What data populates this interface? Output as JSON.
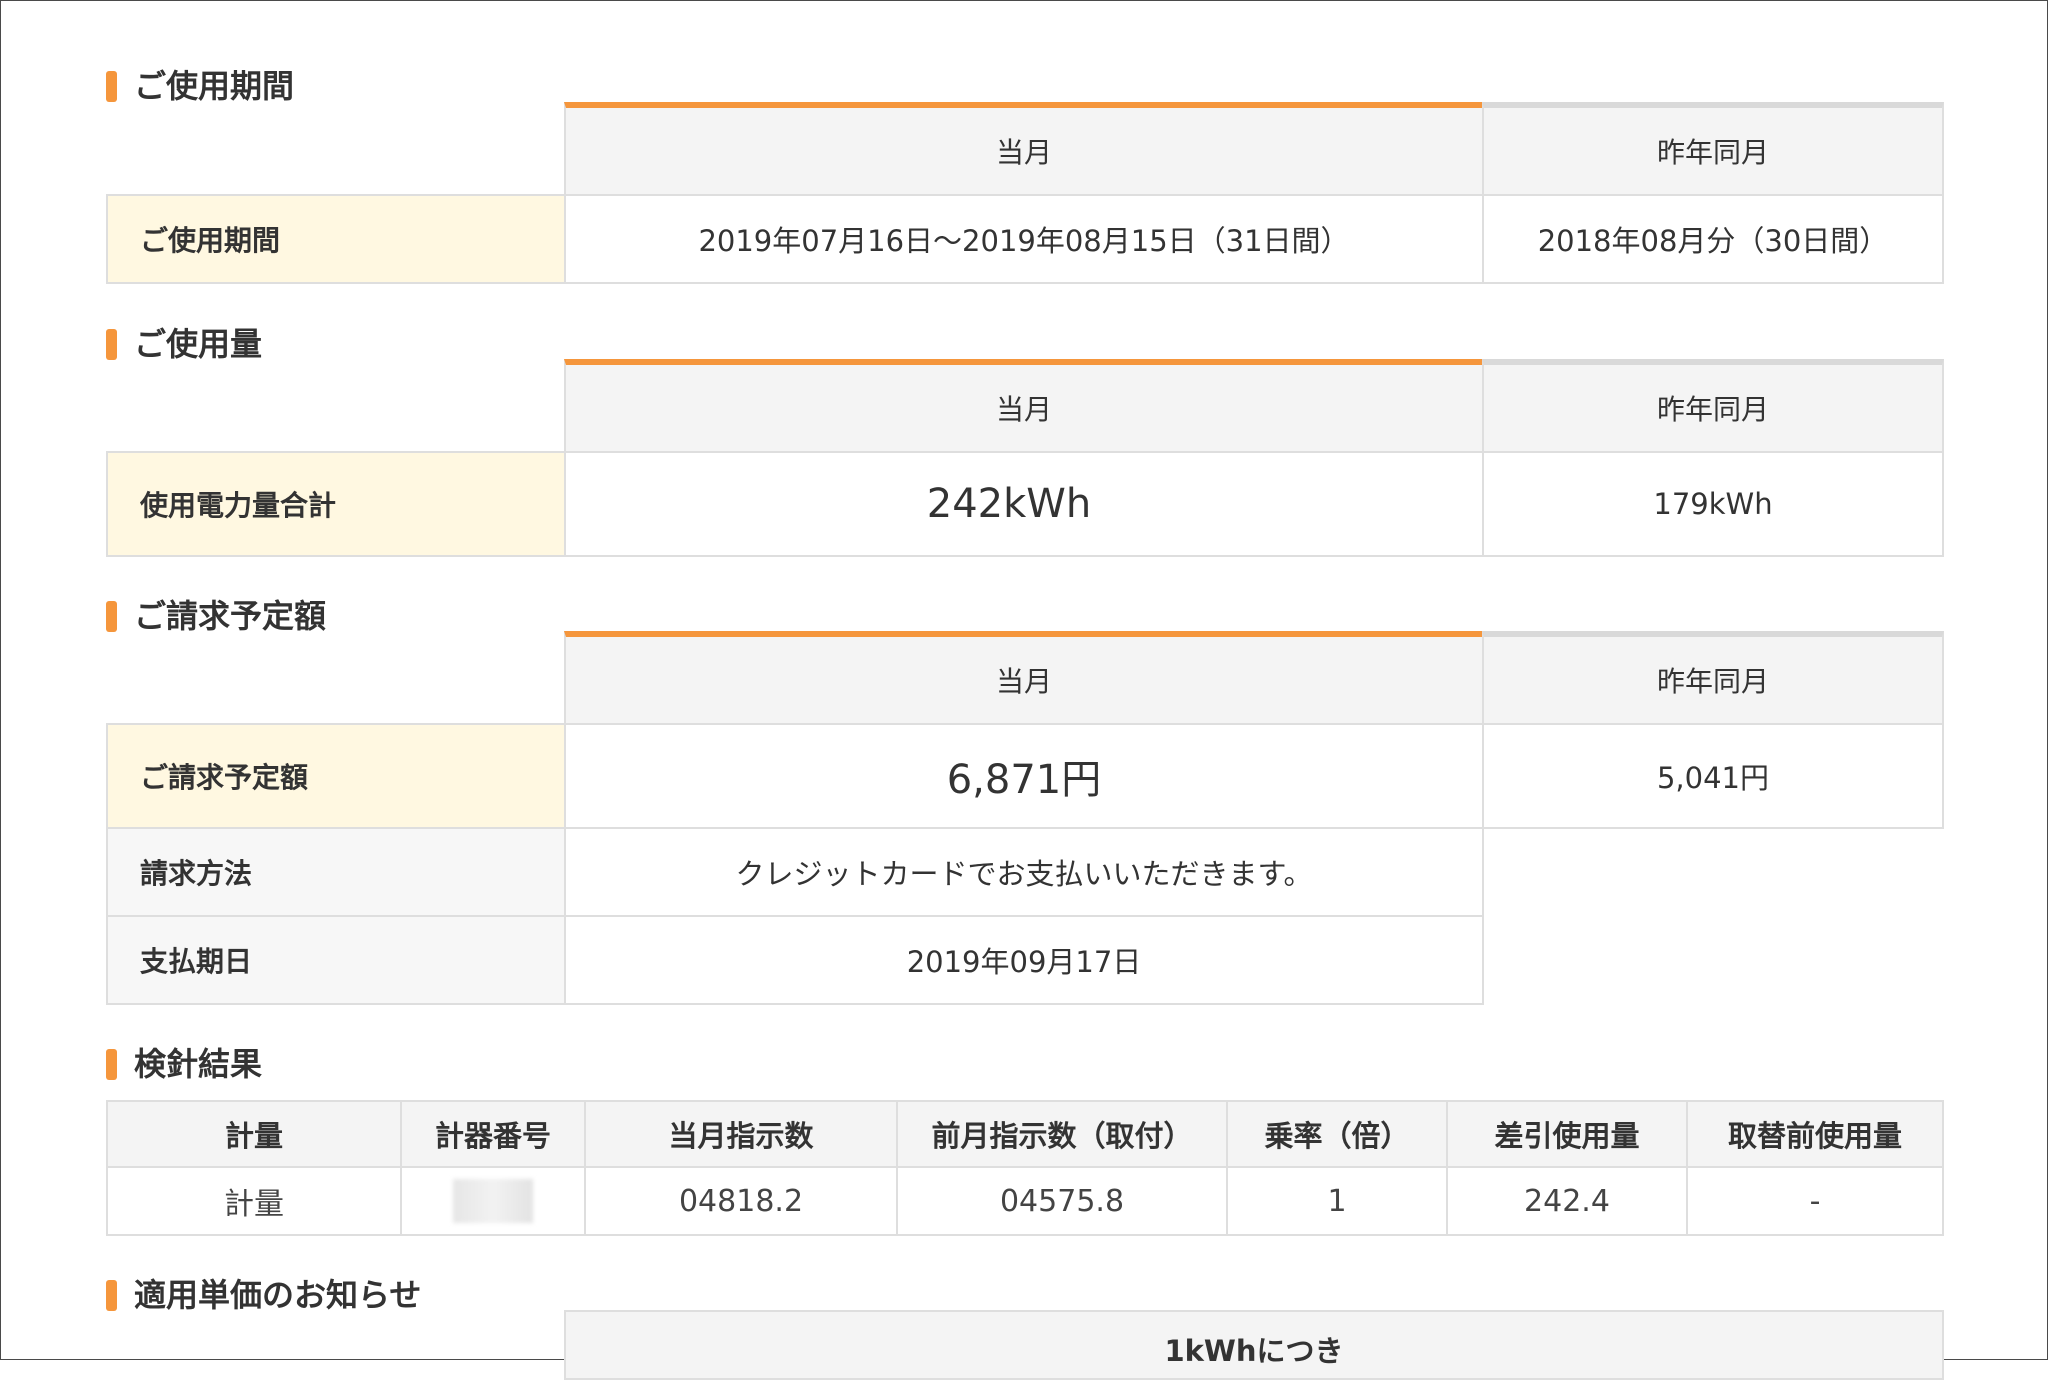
{
  "sections": {
    "period": {
      "title": "ご使用期間",
      "header_current": "当月",
      "header_previous": "昨年同月",
      "row_label": "ご使用期間",
      "current": "2019年07月16日〜2019年08月15日（31日間）",
      "previous": "2018年08月分（30日間）"
    },
    "usage": {
      "title": "ご使用量",
      "header_current": "当月",
      "header_previous": "昨年同月",
      "row_label": "使用電力量合計",
      "current": "242kWh",
      "previous": "179kWh"
    },
    "billing": {
      "title": "ご請求予定額",
      "header_current": "当月",
      "header_previous": "昨年同月",
      "row_label": "ご請求予定額",
      "current": "6,871円",
      "previous": "5,041円",
      "method_label": "請求方法",
      "method_value": "クレジットカードでお支払いいただきます。",
      "due_label": "支払期日",
      "due_value": "2019年09月17日"
    },
    "meter": {
      "title": "検針結果",
      "headers": [
        "計量",
        "計器番号",
        "当月指示数",
        "前月指示数（取付）",
        "乗率（倍）",
        "差引使用量",
        "取替前使用量"
      ],
      "row": {
        "type": "計量",
        "meter_no": "",
        "current_reading": "04818.2",
        "previous_reading": "04575.8",
        "multiplier": "1",
        "usage": "242.4",
        "before_replacement": "-"
      }
    },
    "unit_price": {
      "title": "適用単価のお知らせ",
      "header": "1kWhにつき"
    }
  },
  "colors": {
    "accent": "#f5963c",
    "label_bg": "#fff8e1",
    "header_bg": "#f4f4f4",
    "border": "#dedede"
  }
}
